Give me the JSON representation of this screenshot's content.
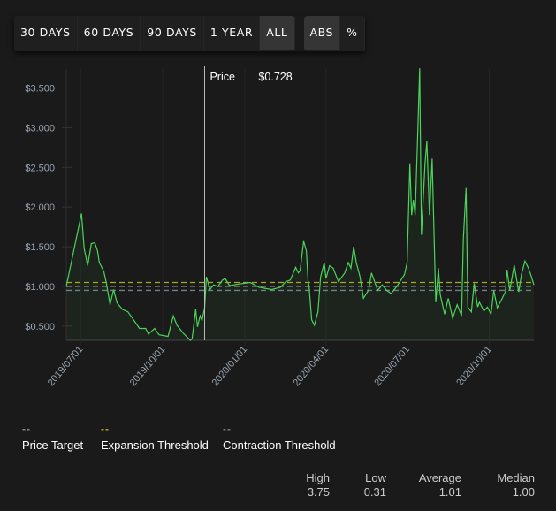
{
  "toolbar": {
    "range_buttons": [
      {
        "label": "30 DAYS",
        "active": false
      },
      {
        "label": "60 DAYS",
        "active": false
      },
      {
        "label": "90 DAYS",
        "active": false
      },
      {
        "label": "1 YEAR",
        "active": false
      },
      {
        "label": "ALL",
        "active": true
      }
    ],
    "mode_buttons": [
      {
        "label": "ABS",
        "active": true
      },
      {
        "label": "%",
        "active": false
      }
    ]
  },
  "tooltip": {
    "label": "Price",
    "value": "$0.728",
    "date": "2019-11-17"
  },
  "legend": [
    {
      "label": "Price Target",
      "color": "#8a8a8a"
    },
    {
      "label": "Expansion Threshold",
      "color": "#a8a81c"
    },
    {
      "label": "Contraction Threshold",
      "color": "#6f8088"
    }
  ],
  "stats": [
    {
      "label": "High",
      "value": "3.75"
    },
    {
      "label": "Low",
      "value": "0.31"
    },
    {
      "label": "Average",
      "value": "1.01"
    },
    {
      "label": "Median",
      "value": "1.00"
    }
  ],
  "chart_data": {
    "type": "line",
    "xlabel": "",
    "ylabel": "",
    "xlim": [
      "2019-06-15",
      "2020-11-20"
    ],
    "ylim": [
      0.32,
      3.74
    ],
    "grid": true,
    "line_color": "#4cd35a",
    "y_ticks": [
      0.5,
      1.0,
      1.5,
      2.0,
      2.5,
      3.0,
      3.5
    ],
    "y_tick_labels": [
      "$0.500",
      "$1.000",
      "$1.500",
      "$2.000",
      "$2.500",
      "$3.000",
      "$3.500"
    ],
    "x_ticks": [
      "2019-07-01",
      "2019-10-01",
      "2020-01-01",
      "2020-04-01",
      "2020-07-01",
      "2020-10-01"
    ],
    "x_tick_labels": [
      "2019/07/01",
      "2019/10/01",
      "2020/01/01",
      "2020/04/01",
      "2020/07/01",
      "2020/10/01"
    ],
    "reference_lines": [
      {
        "name": "Price Target",
        "value": 1.0,
        "color": "#8a8a8a"
      },
      {
        "name": "Expansion Threshold",
        "value": 1.05,
        "color": "#a8a81c"
      },
      {
        "name": "Contraction Threshold",
        "value": 0.95,
        "color": "#6f8088"
      }
    ],
    "series": [
      {
        "points": [
          [
            "2019-06-15",
            1.0
          ],
          [
            "2019-07-02",
            1.92
          ],
          [
            "2019-07-05",
            1.48
          ],
          [
            "2019-07-09",
            1.26
          ],
          [
            "2019-07-13",
            1.54
          ],
          [
            "2019-07-17",
            1.55
          ],
          [
            "2019-07-20",
            1.45
          ],
          [
            "2019-07-22",
            1.3
          ],
          [
            "2019-07-27",
            1.19
          ],
          [
            "2019-07-30",
            1.04
          ],
          [
            "2019-08-03",
            0.77
          ],
          [
            "2019-08-07",
            0.96
          ],
          [
            "2019-08-11",
            0.79
          ],
          [
            "2019-08-17",
            0.71
          ],
          [
            "2019-08-23",
            0.68
          ],
          [
            "2019-08-30",
            0.57
          ],
          [
            "2019-09-05",
            0.47
          ],
          [
            "2019-09-12",
            0.47
          ],
          [
            "2019-09-15",
            0.4
          ],
          [
            "2019-09-22",
            0.47
          ],
          [
            "2019-09-27",
            0.39
          ],
          [
            "2019-10-07",
            0.37
          ],
          [
            "2019-10-13",
            0.63
          ],
          [
            "2019-10-17",
            0.51
          ],
          [
            "2019-10-24",
            0.41
          ],
          [
            "2019-11-01",
            0.32
          ],
          [
            "2019-11-03",
            0.34
          ],
          [
            "2019-11-07",
            0.71
          ],
          [
            "2019-11-09",
            0.49
          ],
          [
            "2019-11-12",
            0.63
          ],
          [
            "2019-11-14",
            0.57
          ],
          [
            "2019-11-17",
            0.73
          ],
          [
            "2019-11-19",
            1.12
          ],
          [
            "2019-11-23",
            0.96
          ],
          [
            "2019-11-27",
            1.02
          ],
          [
            "2019-12-02",
            1.0
          ],
          [
            "2019-12-07",
            1.08
          ],
          [
            "2019-12-10",
            1.1
          ],
          [
            "2019-12-15",
            1.01
          ],
          [
            "2019-12-25",
            1.03
          ],
          [
            "2020-01-07",
            1.05
          ],
          [
            "2020-01-17",
            0.99
          ],
          [
            "2020-01-31",
            0.96
          ],
          [
            "2020-02-10",
            0.99
          ],
          [
            "2020-02-16",
            1.06
          ],
          [
            "2020-02-21",
            1.08
          ],
          [
            "2020-02-27",
            1.24
          ],
          [
            "2020-03-01",
            1.17
          ],
          [
            "2020-03-03",
            1.2
          ],
          [
            "2020-03-07",
            1.57
          ],
          [
            "2020-03-10",
            1.45
          ],
          [
            "2020-03-12",
            1.06
          ],
          [
            "2020-03-13",
            1.01
          ],
          [
            "2020-03-16",
            0.58
          ],
          [
            "2020-03-19",
            0.51
          ],
          [
            "2020-03-23",
            0.68
          ],
          [
            "2020-03-26",
            1.12
          ],
          [
            "2020-03-30",
            1.3
          ],
          [
            "2020-04-01",
            1.1
          ],
          [
            "2020-04-05",
            1.26
          ],
          [
            "2020-04-09",
            1.23
          ],
          [
            "2020-04-15",
            1.06
          ],
          [
            "2020-04-22",
            1.17
          ],
          [
            "2020-04-26",
            1.3
          ],
          [
            "2020-04-29",
            1.23
          ],
          [
            "2020-05-02",
            1.5
          ],
          [
            "2020-05-05",
            1.3
          ],
          [
            "2020-05-09",
            1.13
          ],
          [
            "2020-05-13",
            0.85
          ],
          [
            "2020-05-19",
            0.96
          ],
          [
            "2020-05-22",
            1.17
          ],
          [
            "2020-05-29",
            0.95
          ],
          [
            "2020-06-03",
            1.02
          ],
          [
            "2020-06-08",
            0.95
          ],
          [
            "2020-06-13",
            0.91
          ],
          [
            "2020-06-20",
            1.01
          ],
          [
            "2020-06-28",
            1.15
          ],
          [
            "2020-07-01",
            1.3
          ],
          [
            "2020-07-04",
            2.55
          ],
          [
            "2020-07-06",
            1.9
          ],
          [
            "2020-07-08",
            2.09
          ],
          [
            "2020-07-10",
            1.9
          ],
          [
            "2020-07-13",
            3.0
          ],
          [
            "2020-07-15",
            3.75
          ],
          [
            "2020-07-17",
            1.65
          ],
          [
            "2020-07-21",
            2.54
          ],
          [
            "2020-07-23",
            2.83
          ],
          [
            "2020-07-26",
            1.9
          ],
          [
            "2020-07-29",
            2.61
          ],
          [
            "2020-08-02",
            0.8
          ],
          [
            "2020-08-05",
            1.23
          ],
          [
            "2020-08-07",
            0.9
          ],
          [
            "2020-08-12",
            0.65
          ],
          [
            "2020-08-16",
            0.85
          ],
          [
            "2020-08-21",
            0.6
          ],
          [
            "2020-08-26",
            0.77
          ],
          [
            "2020-08-31",
            0.63
          ],
          [
            "2020-09-02",
            1.6
          ],
          [
            "2020-09-05",
            2.24
          ],
          [
            "2020-09-07",
            0.74
          ],
          [
            "2020-09-11",
            0.68
          ],
          [
            "2020-09-14",
            1.04
          ],
          [
            "2020-09-18",
            0.74
          ],
          [
            "2020-09-20",
            0.8
          ],
          [
            "2020-09-25",
            0.69
          ],
          [
            "2020-09-29",
            0.74
          ],
          [
            "2020-10-03",
            0.65
          ],
          [
            "2020-10-06",
            0.95
          ],
          [
            "2020-10-10",
            0.73
          ],
          [
            "2020-10-15",
            0.84
          ],
          [
            "2020-10-19",
            0.93
          ],
          [
            "2020-10-21",
            1.21
          ],
          [
            "2020-10-24",
            0.95
          ],
          [
            "2020-10-29",
            1.27
          ],
          [
            "2020-11-03",
            0.93
          ],
          [
            "2020-11-06",
            1.15
          ],
          [
            "2020-11-10",
            1.32
          ],
          [
            "2020-11-14",
            1.23
          ],
          [
            "2020-11-17",
            1.13
          ],
          [
            "2020-11-20",
            1.02
          ]
        ]
      }
    ]
  }
}
